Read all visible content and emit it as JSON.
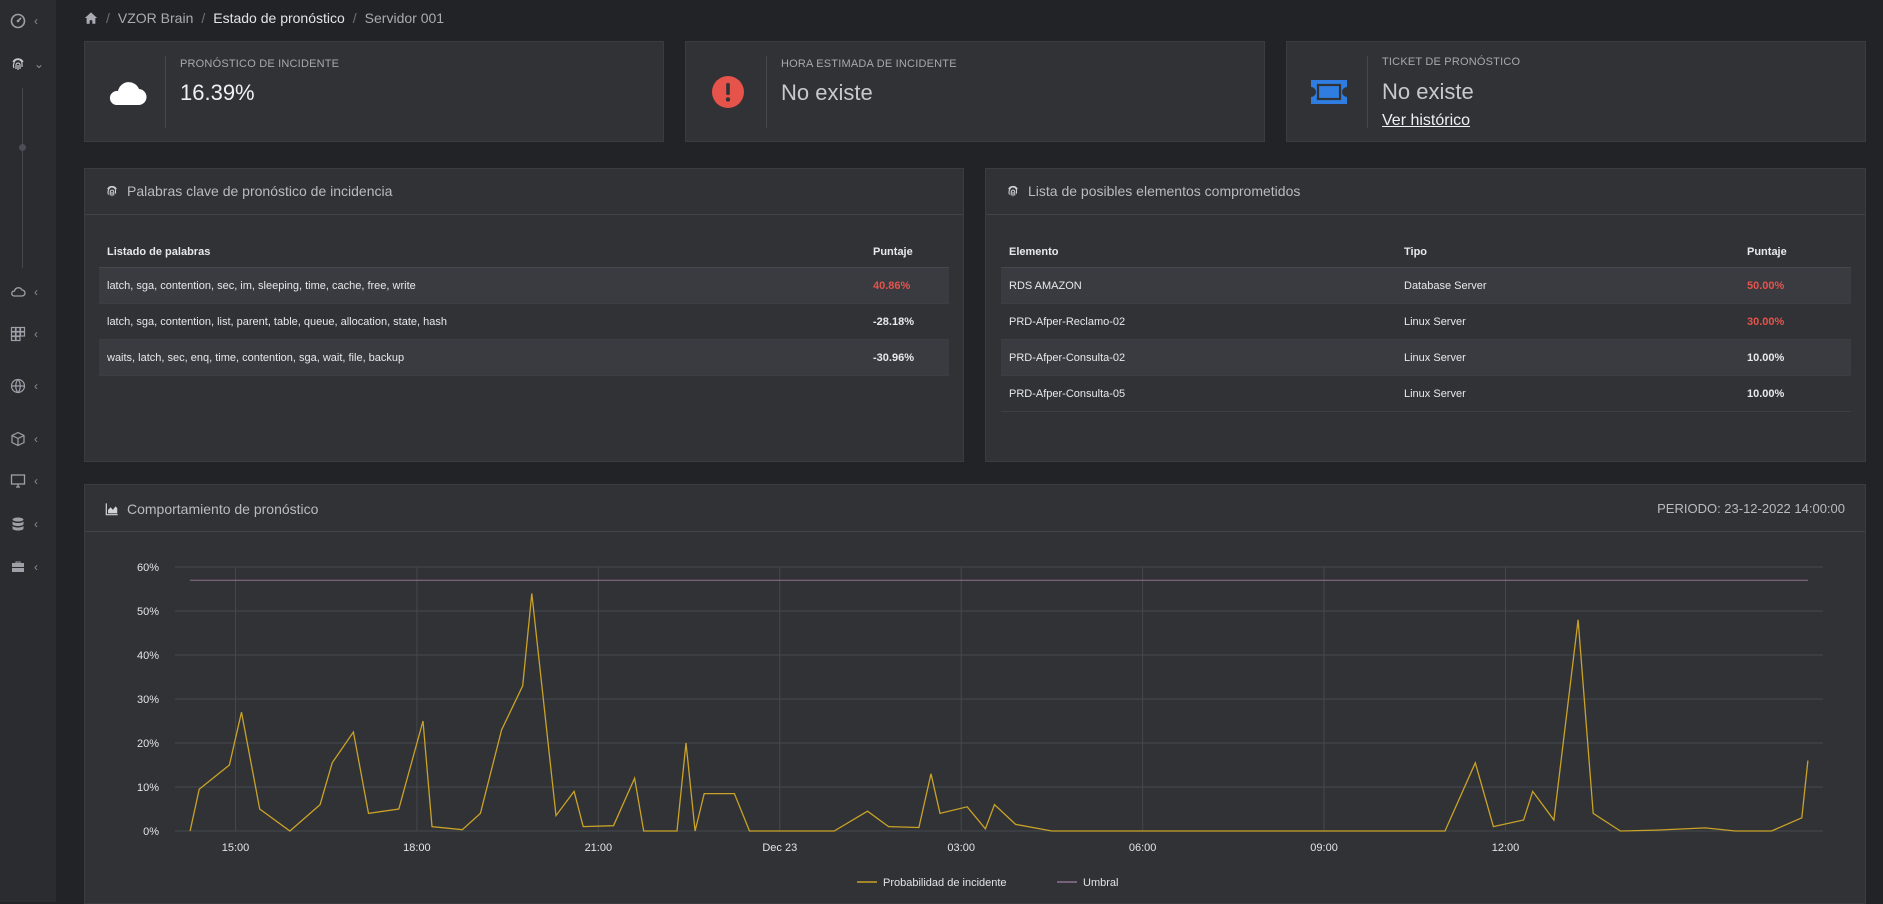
{
  "sidebar": {
    "items": [
      {
        "icon": "dashboard-icon",
        "chevron": "‹"
      },
      {
        "icon": "fingerprint-icon",
        "chevron": "⌄"
      },
      {
        "icon": "cloud-icon",
        "chevron": "‹"
      },
      {
        "icon": "grid-icon",
        "chevron": "‹"
      },
      {
        "icon": "globe-icon",
        "chevron": "‹"
      },
      {
        "icon": "cube-icon",
        "chevron": "‹"
      },
      {
        "icon": "monitor-icon",
        "chevron": "‹"
      },
      {
        "icon": "database-icon",
        "chevron": "‹"
      },
      {
        "icon": "toolbox-icon",
        "chevron": "‹"
      }
    ]
  },
  "breadcrumb": {
    "b1": "VZOR Brain",
    "b2": "Estado de pronóstico",
    "b3": "Servidor 001",
    "sep": "/"
  },
  "stats": {
    "incident": {
      "label": "PRONÓSTICO DE INCIDENTE",
      "value": "16.39%",
      "icon": "cloud-icon"
    },
    "hora": {
      "label": "HORA ESTIMADA DE INCIDENTE",
      "value": "No existe",
      "icon": "alert-icon"
    },
    "ticket": {
      "label": "TICKET DE PRONÓSTICO",
      "value": "No existe",
      "link": "Ver histórico",
      "icon": "ticket-icon"
    }
  },
  "keywords": {
    "title": "Palabras clave de pronóstico de incidencia",
    "col1": "Listado de palabras",
    "col2": "Puntaje",
    "rows": [
      {
        "words": "latch, sga, contention, sec, im, sleeping, time, cache, free, write",
        "score": "40.86%"
      },
      {
        "words": "latch, sga, contention, list, parent, table, queue, allocation, state, hash",
        "score": "-28.18%"
      },
      {
        "words": "waits, latch, sec, enq, time, contention, sga, wait, file, backup",
        "score": "-30.96%"
      }
    ]
  },
  "elements": {
    "title": "Lista de posibles elementos comprometidos",
    "col1": "Elemento",
    "col2": "Tipo",
    "col3": "Puntaje",
    "rows": [
      {
        "name": "RDS AMAZON",
        "type": "Database Server",
        "score": "50.00%"
      },
      {
        "name": "PRD-Afper-Reclamo-02",
        "type": "Linux Server",
        "score": "30.00%"
      },
      {
        "name": "PRD-Afper-Consulta-02",
        "type": "Linux Server",
        "score": "10.00%"
      },
      {
        "name": "PRD-Afper-Consulta-05",
        "type": "Linux Server",
        "score": "10.00%"
      }
    ]
  },
  "chart_panel": {
    "title": "Comportamiento de pronóstico",
    "periodo": "PERIODO: 23-12-2022 14:00:00"
  },
  "colors": {
    "line": "#c9a227",
    "threshold": "#8e6f90",
    "red": "#e5534b",
    "accent_blue": "#2f7de1"
  },
  "chart_data": {
    "type": "line",
    "x_unit": "hours since 2022-12-22 14:00",
    "xlim": [
      0,
      24
    ],
    "ylim": [
      0,
      60
    ],
    "yticks": [
      0,
      10,
      20,
      30,
      40,
      50,
      60
    ],
    "ytick_labels": [
      "0%",
      "10%",
      "20%",
      "30%",
      "40%",
      "50%",
      "60%"
    ],
    "xticks": [
      1,
      4,
      7,
      10,
      13,
      16,
      19,
      22
    ],
    "xtick_labels": [
      "15:00",
      "18:00",
      "21:00",
      "Dec 23",
      "03:00",
      "06:00",
      "09:00",
      "12:00"
    ],
    "grid": true,
    "legend_position": "bottom",
    "series": [
      {
        "name": "Probabilidad de incidente",
        "color": "#c9a227",
        "points": [
          [
            0.25,
            0
          ],
          [
            0.4,
            9.5
          ],
          [
            0.9,
            15
          ],
          [
            1.1,
            27
          ],
          [
            1.4,
            5
          ],
          [
            1.9,
            0
          ],
          [
            2.4,
            6
          ],
          [
            2.6,
            15.5
          ],
          [
            2.95,
            22.5
          ],
          [
            3.2,
            4
          ],
          [
            3.7,
            5
          ],
          [
            4.1,
            25
          ],
          [
            4.25,
            1
          ],
          [
            4.75,
            0.3
          ],
          [
            5.05,
            4
          ],
          [
            5.4,
            23
          ],
          [
            5.75,
            33
          ],
          [
            5.9,
            54
          ],
          [
            6.3,
            3.5
          ],
          [
            6.6,
            9
          ],
          [
            6.75,
            1
          ],
          [
            7.25,
            1.2
          ],
          [
            7.6,
            12
          ],
          [
            7.75,
            0
          ],
          [
            8.3,
            0
          ],
          [
            8.45,
            20
          ],
          [
            8.6,
            0
          ],
          [
            8.75,
            8.5
          ],
          [
            9.25,
            8.5
          ],
          [
            9.5,
            0
          ],
          [
            10.9,
            0
          ],
          [
            11.45,
            4.5
          ],
          [
            11.8,
            1
          ],
          [
            12.3,
            0.8
          ],
          [
            12.5,
            13
          ],
          [
            12.65,
            4
          ],
          [
            13.1,
            5.5
          ],
          [
            13.4,
            0.5
          ],
          [
            13.55,
            6
          ],
          [
            13.9,
            1.5
          ],
          [
            14.5,
            0
          ],
          [
            21.0,
            0
          ],
          [
            21.5,
            15.5
          ],
          [
            21.8,
            1
          ],
          [
            22.3,
            2.5
          ],
          [
            22.45,
            9
          ],
          [
            22.8,
            2.5
          ],
          [
            23.2,
            48
          ],
          [
            23.45,
            4
          ],
          [
            23.9,
            0
          ],
          [
            24.5,
            0.2
          ],
          [
            25.3,
            0.7
          ],
          [
            25.8,
            0
          ],
          [
            26.4,
            0
          ],
          [
            26.9,
            3
          ],
          [
            27.0,
            16
          ]
        ]
      },
      {
        "name": "Umbral",
        "color": "#8e6f90",
        "points": [
          [
            0.25,
            57
          ],
          [
            27.0,
            57
          ]
        ]
      }
    ]
  }
}
